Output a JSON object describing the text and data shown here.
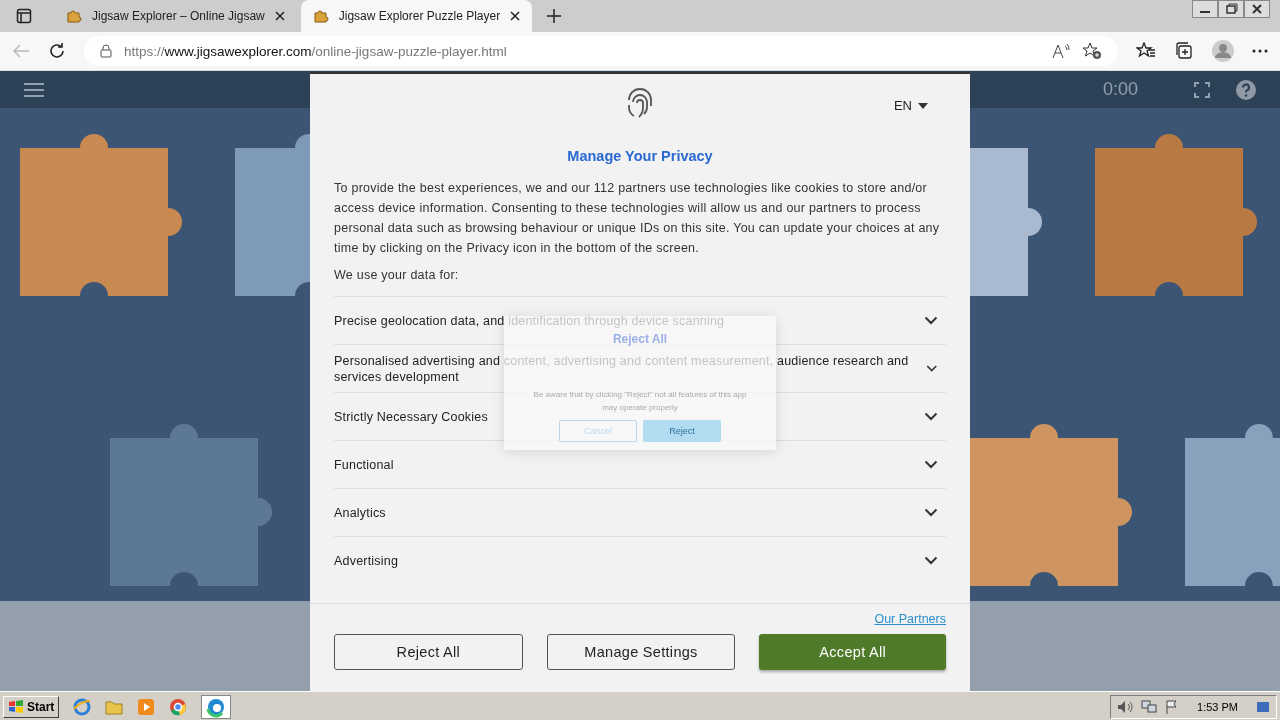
{
  "browser": {
    "tabs": [
      {
        "title": "Jigsaw Explorer – Online Jigsaw",
        "selected": false
      },
      {
        "title": "Jigsaw Explorer Puzzle Player",
        "selected": true
      }
    ],
    "url": {
      "scheme": "https://",
      "host": "www.jigsawexplorer.com",
      "path": "/online-jigsaw-puzzle-player.html"
    }
  },
  "app_bar": {
    "timer": "0:00"
  },
  "consent": {
    "language": "EN",
    "title": "Manage Your Privacy",
    "intro": "To provide the best experiences, we and our 112 partners use technologies like cookies to store and/or access device information. Consenting to these technologies will allow us and our partners to process personal data such as browsing behaviour or unique IDs on this site. You can update your choices at any time by clicking on the Privacy icon in the bottom of the screen.",
    "subtitle": "We use your data for:",
    "purposes": [
      {
        "label": "Precise geolocation data, and identification through device scanning",
        "expanded": false
      },
      {
        "label": "Personalised advertising and content, advertising and content measurement, audience research and services development",
        "expanded": false
      },
      {
        "label": "Strictly Necessary Cookies",
        "expanded": false
      },
      {
        "label": "Functional",
        "expanded": false
      },
      {
        "label": "Analytics",
        "expanded": false
      },
      {
        "label": "Advertising",
        "expanded": false
      }
    ],
    "partners_link": "Our Partners",
    "buttons": [
      {
        "label": "Reject All",
        "kind": "outline"
      },
      {
        "label": "Manage Settings",
        "kind": "outline"
      },
      {
        "label": "Accept All",
        "kind": "primary"
      }
    ]
  },
  "confirm_dialog": {
    "title": "Reject All",
    "message": "Be aware that by clicking \"Reject\" not all features of this app may operate properly",
    "buttons": [
      {
        "label": "Cancel",
        "kind": "outline"
      },
      {
        "label": "Reject",
        "kind": "primary"
      }
    ]
  },
  "taskbar": {
    "start": "Start",
    "clock": "1:53 PM"
  }
}
